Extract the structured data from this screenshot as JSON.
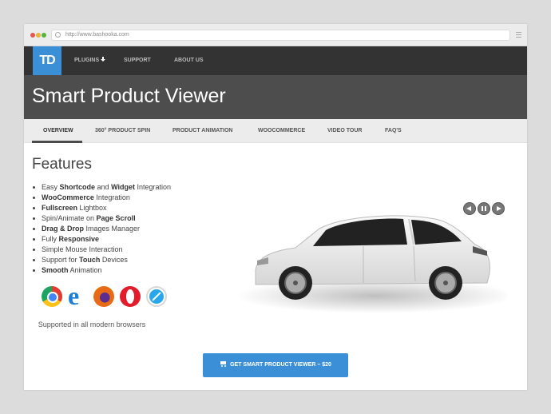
{
  "browser": {
    "url": "http://www.bashooka.com"
  },
  "header": {
    "logo_text": "TD",
    "nav": [
      {
        "label": "PLUGINS"
      },
      {
        "label": "SUPPORT"
      },
      {
        "label": "ABOUT US"
      }
    ]
  },
  "hero": {
    "title": "Smart Product Viewer"
  },
  "subnav": {
    "items": [
      {
        "label": "OVERVIEW"
      },
      {
        "label": "360° PRODUCT SPIN"
      },
      {
        "label": "PRODUCT ANIMATION"
      },
      {
        "label": "WOOCOMMERCE"
      },
      {
        "label": "VIDEO TOUR"
      },
      {
        "label": "FAQ'S"
      }
    ]
  },
  "features": {
    "title": "Features",
    "items": [
      {
        "pre": "Easy ",
        "b1": "Shortcode",
        "mid": " and ",
        "b2": "Widget",
        "post": " Integration"
      },
      {
        "pre": "",
        "b1": "WooCommerce",
        "mid": " Integration",
        "b2": "",
        "post": ""
      },
      {
        "pre": "",
        "b1": "Fullscreen",
        "mid": " Lightbox",
        "b2": "",
        "post": ""
      },
      {
        "pre": "Spin/Animate on ",
        "b1": "Page Scroll",
        "mid": "",
        "b2": "",
        "post": ""
      },
      {
        "pre": "",
        "b1": "Drag & Drop",
        "mid": " Images Manager",
        "b2": "",
        "post": ""
      },
      {
        "pre": "Fully ",
        "b1": "Responsive",
        "mid": "",
        "b2": "",
        "post": ""
      },
      {
        "pre": "Simple Mouse Interaction",
        "b1": "",
        "mid": "",
        "b2": "",
        "post": ""
      },
      {
        "pre": "Support for ",
        "b1": "Touch",
        "mid": " Devices",
        "b2": "",
        "post": ""
      },
      {
        "pre": "",
        "b1": "Smooth",
        "mid": " Animation",
        "b2": "",
        "post": ""
      }
    ],
    "browser_icons": [
      "chrome-icon",
      "edge-icon",
      "firefox-icon",
      "opera-icon",
      "safari-icon"
    ],
    "supported_text": "Supported in all modern browsers"
  },
  "cta": {
    "label": "GET SMART PRODUCT VIEWER – $20"
  },
  "colors": {
    "accent": "#3a8fd6",
    "header_bg": "#333333",
    "hero_bg": "#4d4d4d"
  }
}
